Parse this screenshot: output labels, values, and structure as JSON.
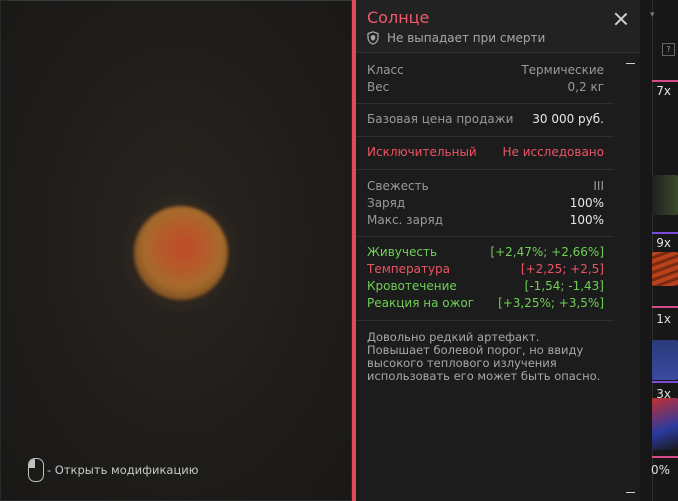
{
  "preview": {
    "mod_hint": "- Открыть модификацию"
  },
  "item": {
    "name": "Солнце",
    "drop_note": "Не выпадает при смерти",
    "stats_basic": [
      {
        "label": "Класс",
        "value": "Термические"
      },
      {
        "label": "Вес",
        "value": "0,2 кг"
      }
    ],
    "price": {
      "label": "Базовая цена продажи",
      "value": "30 000 руб."
    },
    "rarity": {
      "label": "Исключительный",
      "value": "Не исследовано"
    },
    "condition": [
      {
        "label": "Свежесть",
        "value": "III"
      },
      {
        "label": "Заряд",
        "value": "100%"
      },
      {
        "label": "Макс. заряд",
        "value": "100%"
      }
    ],
    "effects": [
      {
        "label": "Живучесть",
        "value": "[+2,47%; +2,66%]",
        "tone": "positive"
      },
      {
        "label": "Температура",
        "value": "[+2,25; +2,5]",
        "tone": "negative"
      },
      {
        "label": "Кровотечение",
        "value": "[-1,54; -1,43]",
        "tone": "positive"
      },
      {
        "label": "Реакция на ожог",
        "value": "[+3,25%; +3,5%]",
        "tone": "positive"
      }
    ],
    "description": "Довольно редкий артефакт. Повышает болевой порог, но ввиду высокого теплового излучения использовать его может быть опасно."
  },
  "inventory_strip": {
    "help_label": "?",
    "counts": [
      "7x",
      "9x",
      "1x",
      "3x",
      "0%"
    ]
  },
  "colors": {
    "accent": "#e14a5a",
    "positive": "#6fcf56",
    "negative": "#ee5464"
  }
}
